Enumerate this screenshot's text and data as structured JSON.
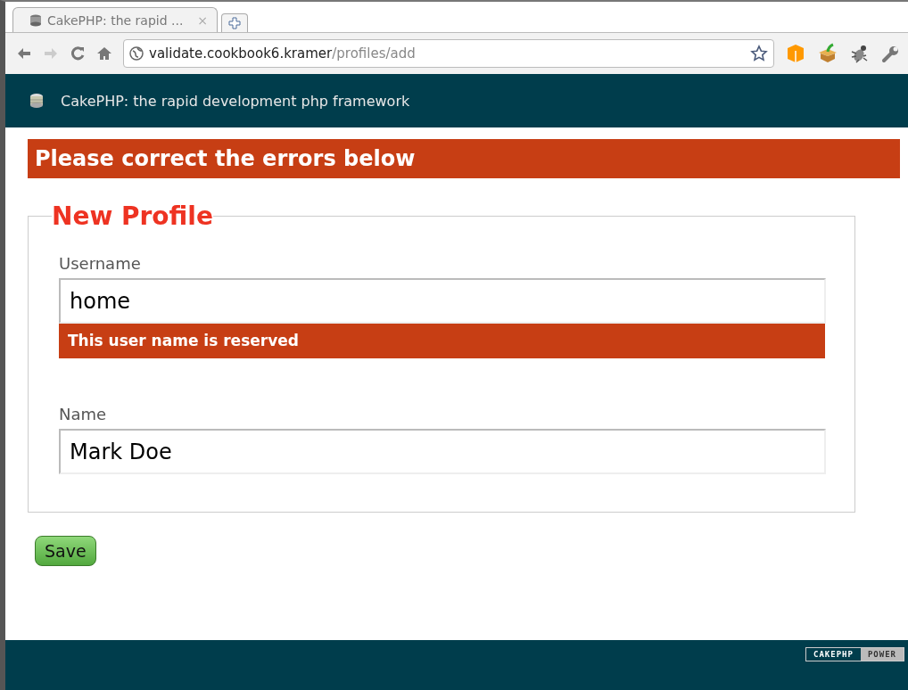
{
  "browser": {
    "tab": {
      "title": "CakePHP: the rapid ...",
      "close": "×"
    },
    "url": {
      "host": "validate.cookbook6.kramer",
      "path": "/profiles/add"
    }
  },
  "header": {
    "title": "CakePHP: the rapid development php framework"
  },
  "flash": "Please correct the errors below",
  "form": {
    "legend": "New Profile",
    "fields": [
      {
        "label": "Username",
        "value": "home",
        "error": "This user name is reserved"
      },
      {
        "label": "Name",
        "value": "Mark Doe"
      }
    ],
    "submit": "Save"
  },
  "footer": {
    "badge": [
      "CAKEPHP",
      "POWER"
    ]
  }
}
